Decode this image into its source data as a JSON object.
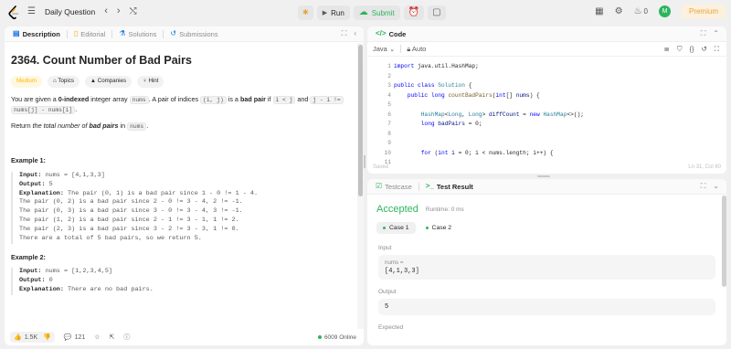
{
  "topbar": {
    "title": "Daily Question",
    "run": "Run",
    "submit": "Submit",
    "streak": "0",
    "avatar": "M",
    "premium": "Premium"
  },
  "left_tabs": [
    "Description",
    "Editorial",
    "Solutions",
    "Submissions"
  ],
  "problem": {
    "title": "2364. Count Number of Bad Pairs",
    "difficulty": "Medium",
    "tags": [
      "Topics",
      "Companies",
      "Hint"
    ],
    "p1_a": "You are given a ",
    "p1_b": "0-indexed",
    "p1_c": " integer array ",
    "p1_nums": "nums",
    "p1_d": ". A pair of indices ",
    "p1_ij": "(i, j)",
    "p1_e": " is a ",
    "p1_bad": "bad pair",
    "p1_f": " if ",
    "p1_lt": "i < j",
    "p1_g": " and ",
    "p1_expr": "j - i !=",
    "p1_expr2": "nums[j] - nums[i]",
    "p1_end": ".",
    "p2_a": "Return ",
    "p2_b": "the total number of ",
    "p2_c": "bad pairs",
    "p2_d": " in ",
    "p2_nums": "nums",
    "p2_end": "."
  },
  "examples": [
    {
      "heading": "Example 1:",
      "input_label": "Input:",
      "input": " nums = [4,1,3,3]",
      "output_label": "Output:",
      "output": " 5",
      "expl_label": "Explanation:",
      "lines": [
        " The pair (0, 1) is a bad pair since 1 - 0 != 1 - 4.",
        "The pair (0, 2) is a bad pair since 2 - 0 != 3 - 4, 2 != -1.",
        "The pair (0, 3) is a bad pair since 3 - 0 != 3 - 4, 3 != -1.",
        "The pair (1, 2) is a bad pair since 2 - 1 != 3 - 1, 1 != 2.",
        "The pair (2, 3) is a bad pair since 3 - 2 != 3 - 3, 1 != 0.",
        "There are a total of 5 bad pairs, so we return 5."
      ]
    },
    {
      "heading": "Example 2:",
      "input_label": "Input:",
      "input": " nums = [1,2,3,4,5]",
      "output_label": "Output:",
      "output": " 0",
      "expl_label": "Explanation:",
      "lines": [
        " There are no bad pairs."
      ]
    }
  ],
  "footer": {
    "likes": "1.5K",
    "comments": "121",
    "online": "6009 Online"
  },
  "code_panel": {
    "tab": "Code",
    "language": "Java",
    "auto": "Auto",
    "saved": "Saved",
    "cursor": "Ln 31, Col 60",
    "line_numbers": [
      "1",
      "2",
      "3",
      "4",
      "5",
      "6",
      "7",
      "8",
      "9",
      "10",
      "11"
    ]
  },
  "test_panel": {
    "tab_case": "Testcase",
    "tab_result": "Test Result",
    "status": "Accepted",
    "runtime": "Runtime: 0 ms",
    "cases": [
      "Case 1",
      "Case 2"
    ],
    "input_label": "Input",
    "var_label": "nums =",
    "var_value": "[4,1,3,3]",
    "output_label": "Output",
    "output_value": "5",
    "expected_label": "Expected"
  }
}
